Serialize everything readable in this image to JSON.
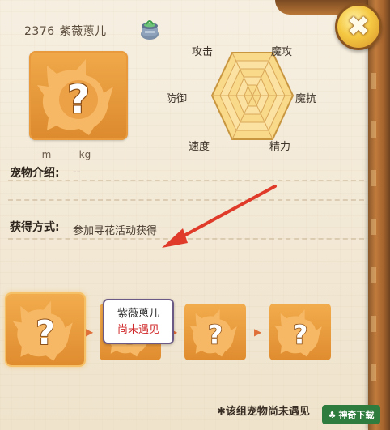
{
  "header": {
    "number": "2376",
    "name": "紫薇蔥儿"
  },
  "close_label": "✖",
  "size": {
    "height": "--m",
    "weight": "--kg"
  },
  "stats": {
    "attack": "攻击",
    "magic_attack": "魔攻",
    "magic_defense": "魔抗",
    "energy": "精力",
    "speed": "速度",
    "defense": "防御"
  },
  "intro": {
    "label": "宠物介绍",
    "value": "--"
  },
  "obtain": {
    "label": "获得方式",
    "value": "参加寻花活动获得"
  },
  "tooltip": {
    "name": "紫薇蔥儿",
    "status": "尚未遇见"
  },
  "evolution": {
    "arrow": "▶"
  },
  "footer": {
    "note": "✱该组宠物尚未遇见"
  },
  "watermark": {
    "text": "神奇下载"
  },
  "colors": {
    "tile": "#e99a3d",
    "accent": "#f5c842",
    "arrow": "#e03a2a",
    "status_red": "#d0282a"
  }
}
